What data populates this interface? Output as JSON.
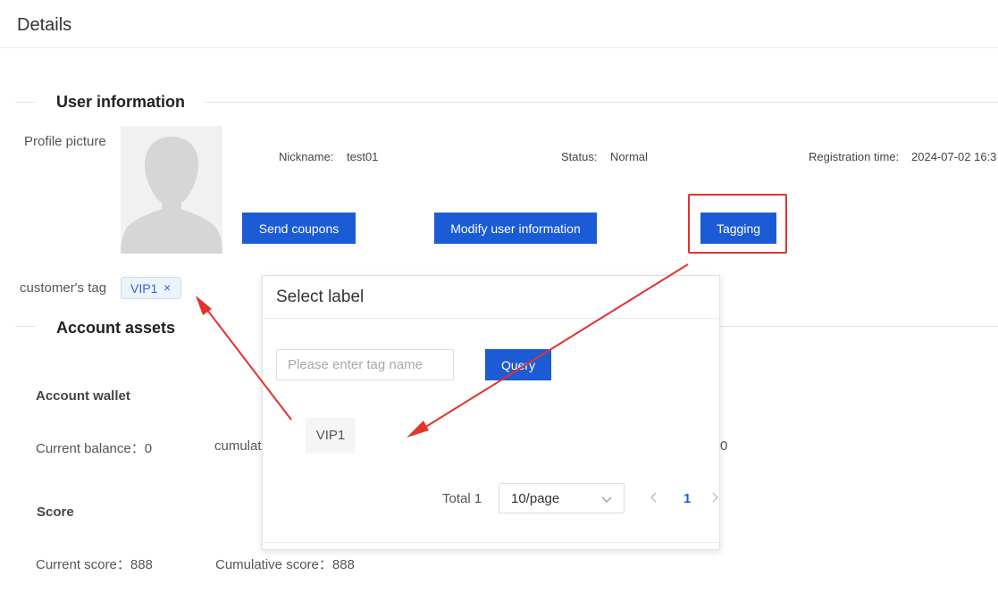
{
  "header": {
    "title": "Details"
  },
  "user_section": {
    "title": "User information",
    "profile_picture_label": "Profile picture",
    "nickname_label": "Nickname:",
    "nickname_value": "test01",
    "status_label": "Status:",
    "status_value": "Normal",
    "registration_label": "Registration time:",
    "registration_value": "2024-07-02 16:3",
    "buttons": {
      "send_coupons": "Send coupons",
      "modify_user_info": "Modify user information",
      "tagging": "Tagging"
    },
    "tags_label": "customer's tag",
    "tags": [
      {
        "label": "VIP1",
        "close": "×"
      }
    ]
  },
  "assets_section": {
    "title": "Account assets",
    "wallet": {
      "title": "Account wallet",
      "current_balance": "Current balance：0",
      "cumulative_partial": "cumulat",
      "right_partial": "0"
    },
    "score": {
      "title": "Score",
      "current_score": "Current score：888",
      "cumulative_score": "Cumulative score：888"
    }
  },
  "modal": {
    "title": "Select label",
    "search_placeholder": "Please enter tag name",
    "search_value": "",
    "query_label": "Query",
    "options": [
      "VIP1"
    ],
    "pagination": {
      "total": "Total 1",
      "page_size": "10/page",
      "current_page": "1"
    }
  },
  "colors": {
    "primary": "#1c5bd6",
    "annotation_red": "#e5322d",
    "tag_bg": "#ecf3fd",
    "tag_text": "#2b67d3"
  }
}
